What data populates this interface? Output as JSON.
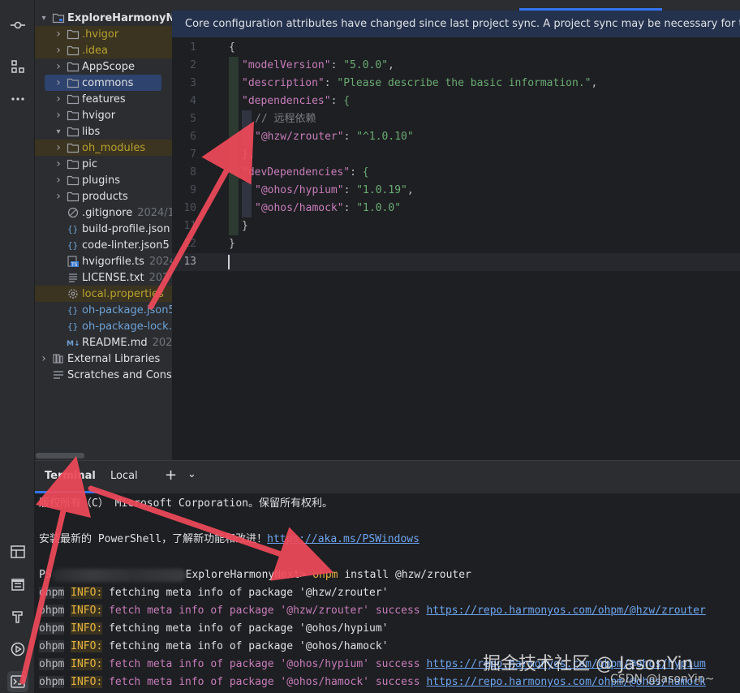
{
  "project": {
    "root": "ExploreHarmonyNext",
    "nodes": [
      {
        "label": ".hvigor",
        "kind": "folder",
        "state": "excluded",
        "meta": ""
      },
      {
        "label": ".idea",
        "kind": "folder",
        "state": "excluded",
        "meta": ""
      },
      {
        "label": "AppScope",
        "kind": "folder",
        "state": "normal",
        "meta": ""
      },
      {
        "label": "commons",
        "kind": "folder",
        "state": "selected",
        "meta": ""
      },
      {
        "label": "features",
        "kind": "folder",
        "state": "normal",
        "meta": ""
      },
      {
        "label": "hvigor",
        "kind": "folder",
        "state": "normal",
        "meta": ""
      },
      {
        "label": "libs",
        "kind": "folder",
        "state": "expanded",
        "meta": ""
      },
      {
        "label": "oh_modules",
        "kind": "folder",
        "state": "excluded",
        "meta": ""
      },
      {
        "label": "pic",
        "kind": "folder",
        "state": "normal",
        "meta": ""
      },
      {
        "label": "plugins",
        "kind": "folder",
        "state": "normal",
        "meta": ""
      },
      {
        "label": "products",
        "kind": "folder",
        "state": "normal",
        "meta": ""
      },
      {
        "label": ".gitignore",
        "kind": "ignore",
        "state": "normal",
        "meta": "2024/1"
      },
      {
        "label": "build-profile.json",
        "kind": "json",
        "state": "normal",
        "meta": ""
      },
      {
        "label": "code-linter.json5",
        "kind": "json",
        "state": "normal",
        "meta": ""
      },
      {
        "label": "hvigorfile.ts",
        "kind": "ts",
        "state": "normal",
        "meta": "2024"
      },
      {
        "label": "LICENSE.txt",
        "kind": "txt",
        "state": "normal",
        "meta": "202"
      },
      {
        "label": "local.properties",
        "kind": "props",
        "state": "excluded-text",
        "meta": ""
      },
      {
        "label": "oh-package.json5",
        "kind": "json",
        "state": "modified",
        "meta": ""
      },
      {
        "label": "oh-package-lock.",
        "kind": "json",
        "state": "modified",
        "meta": ""
      },
      {
        "label": "README.md",
        "kind": "md",
        "state": "normal",
        "meta": "202"
      },
      {
        "label": "External Libraries",
        "kind": "libs",
        "state": "normal",
        "meta": ""
      },
      {
        "label": "Scratches and Cons",
        "kind": "scratch",
        "state": "normal",
        "meta": ""
      }
    ]
  },
  "editor": {
    "notice": "Core configuration attributes have changed since last project sync. A project sync may be necessary for the",
    "line_numbers": [
      "1",
      "2",
      "3",
      "4",
      "5",
      "6",
      "7",
      "8",
      "9",
      "10",
      "11",
      "12",
      "13"
    ],
    "lines": [
      {
        "k": "",
        "sep": "",
        "v": "{",
        "trail": ""
      },
      {
        "k": "\"modelVersion\"",
        "sep": ": ",
        "v": "\"5.0.0\"",
        "trail": ","
      },
      {
        "k": "\"description\"",
        "sep": ": ",
        "v": "\"Please describe the basic information.\"",
        "trail": ","
      },
      {
        "k": "\"dependencies\"",
        "sep": ": ",
        "v": "{",
        "trail": ""
      },
      {
        "comment": "// 远程依赖"
      },
      {
        "k": "\"@hzw/zrouter\"",
        "sep": ": ",
        "v": "\"^1.0.10\"",
        "trail": ""
      },
      {
        "k": "",
        "sep": "",
        "v": "},",
        "trail": ""
      },
      {
        "k": "\"devDependencies\"",
        "sep": ": ",
        "v": "{",
        "trail": ""
      },
      {
        "k": "\"@ohos/hypium\"",
        "sep": ": ",
        "v": "\"1.0.19\"",
        "trail": ","
      },
      {
        "k": "\"@ohos/hamock\"",
        "sep": ": ",
        "v": "\"1.0.0\"",
        "trail": ""
      },
      {
        "k": "",
        "sep": "",
        "v": "}",
        "trail": ""
      },
      {
        "k": "",
        "sep": "",
        "v": "}",
        "trail": ""
      },
      {
        "k": "",
        "sep": "",
        "v": "",
        "trail": ""
      }
    ]
  },
  "terminal": {
    "tabs": [
      "Terminal",
      "Local"
    ],
    "copyright": "版权所有（C） Microsoft Corporation。保留所有权利。",
    "install_prefix": "安装最新的 PowerShell，了解新功能和改进！",
    "install_link": "https://aka.ms/PSWindows",
    "prompt_prefix": "PS",
    "prompt_dir": "ExploreHarmonyNext>",
    "cmd_name": "ohpm",
    "cmd_args": " install @hzw/zrouter",
    "tag_ohpm": "ohpm",
    "tag_info": "INFO:",
    "out": [
      {
        "text": " fetching meta info of package '@hzw/zrouter'",
        "style": "plain",
        "link": ""
      },
      {
        "text": " fetch meta info of package '@hzw/zrouter' success ",
        "style": "mag",
        "link": "https://repo.harmonyos.com/ohpm/@hzw/zrouter"
      },
      {
        "text": " fetching meta info of package '@ohos/hypium'",
        "style": "plain",
        "link": ""
      },
      {
        "text": " fetching meta info of package '@ohos/hamock'",
        "style": "plain",
        "link": ""
      },
      {
        "text": " fetch meta info of package '@ohos/hypium' success ",
        "style": "mag",
        "link": "https://repo.harmonyos.com/ohpm/@ohos/hypium"
      },
      {
        "text": " fetch meta info of package '@ohos/hamock' success ",
        "style": "mag",
        "link": "https://repo.harmonyos.com/ohpm/@ohos/hamock"
      }
    ]
  },
  "watermark": {
    "line1": "掘金技术社区 @ JasonYin",
    "line2": "CSDN @JasonYin~"
  },
  "colors": {
    "accent": "#3574f0",
    "arrow": "#f04a5a",
    "string": "#6aab73",
    "key": "#c77dbb"
  }
}
